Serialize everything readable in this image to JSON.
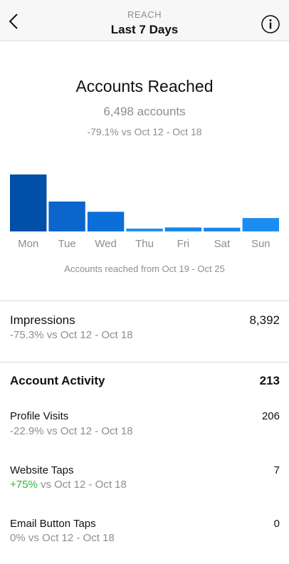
{
  "header": {
    "subtitle": "REACH",
    "title": "Last 7 Days",
    "back_icon": "chevron-left-icon",
    "info_icon": "info-circle-icon"
  },
  "reach": {
    "title": "Accounts Reached",
    "count": "6,498 accounts",
    "change": "-79.1% vs Oct 12 - Oct 18",
    "caption": "Accounts reached from Oct 19 - Oct 25"
  },
  "chart_data": {
    "type": "bar",
    "categories": [
      "Mon",
      "Tue",
      "Wed",
      "Thu",
      "Fri",
      "Sat",
      "Sun"
    ],
    "values": [
      2000,
      1050,
      690,
      100,
      140,
      130,
      470
    ],
    "colors": [
      "#0050a8",
      "#0a66cc",
      "#0a6fd8",
      "#1e90f0",
      "#1787ea",
      "#1787ea",
      "#1a8cf2"
    ]
  },
  "impressions": {
    "label": "Impressions",
    "change": "-75.3% vs Oct 12 - Oct 18",
    "value": "8,392"
  },
  "activity": {
    "label": "Account Activity",
    "value": "213",
    "items": [
      {
        "label": "Profile Visits",
        "change_pct": "-22.9%",
        "change_rest": " vs Oct 12 - Oct 18",
        "value": "206"
      },
      {
        "label": "Website Taps",
        "change_pct": "+75%",
        "change_rest": " vs Oct 12 - Oct 18",
        "value": "7"
      },
      {
        "label": "Email Button Taps",
        "change_pct": "0%",
        "change_rest": " vs Oct 12 - Oct 18",
        "value": "0"
      }
    ]
  },
  "colors": {
    "positive": "#2fb73c",
    "muted": "#8e8e8e"
  }
}
